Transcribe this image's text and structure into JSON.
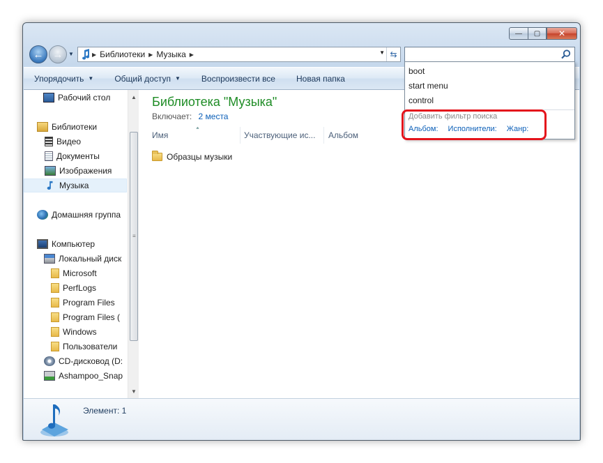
{
  "window": {
    "buttons": {
      "minimize": "—",
      "maximize": "▢",
      "close": "✕"
    }
  },
  "address": {
    "crumbs": [
      "Библиотеки",
      "Музыка"
    ],
    "separator": "▶",
    "dropdown": "▼",
    "refresh": "⇆"
  },
  "search": {
    "value": "",
    "placeholder": ""
  },
  "toolbar": {
    "items": [
      "Упорядочить",
      "Общий доступ",
      "Воспроизвести все",
      "Новая папка"
    ],
    "arrow": "▼"
  },
  "nav": {
    "items": [
      {
        "label": "Рабочий стол",
        "icon": "desktop-icon"
      },
      {
        "label": "Библиотеки",
        "icon": "libraries-icon"
      },
      {
        "label": "Видео",
        "icon": "video-icon"
      },
      {
        "label": "Документы",
        "icon": "documents-icon"
      },
      {
        "label": "Изображения",
        "icon": "pictures-icon"
      },
      {
        "label": "Музыка",
        "icon": "music-icon",
        "selected": true
      },
      {
        "label": "Домашняя группа",
        "icon": "homegroup-icon"
      },
      {
        "label": "Компьютер",
        "icon": "computer-icon"
      },
      {
        "label": "Локальный диск",
        "icon": "drive-icon"
      },
      {
        "label": "Microsoft",
        "icon": "folder-icon"
      },
      {
        "label": "PerfLogs",
        "icon": "folder-icon"
      },
      {
        "label": "Program Files",
        "icon": "folder-icon"
      },
      {
        "label": "Program Files (",
        "icon": "folder-icon"
      },
      {
        "label": "Windows",
        "icon": "folder-icon"
      },
      {
        "label": "Пользователи",
        "icon": "folder-icon"
      },
      {
        "label": "CD-дисковод (D:",
        "icon": "cd-drive-icon"
      },
      {
        "label": "Ashampoo_Snap",
        "icon": "network-drive-icon"
      }
    ]
  },
  "library": {
    "title": "Библиотека \"Музыка\"",
    "includes_label": "Включает:",
    "includes_link": "2 места"
  },
  "columns": [
    "Имя",
    "Участвующие ис...",
    "Альбом"
  ],
  "files": [
    {
      "name": "Образцы музыки",
      "icon": "folder-icon"
    }
  ],
  "status": {
    "text": "Элемент: 1"
  },
  "search_dropdown": {
    "history": [
      "boot",
      "start menu",
      "control"
    ],
    "filter_hint": "Добавить фильтр поиска",
    "filters": [
      "Альбом:",
      "Исполнители:",
      "Жанр:"
    ]
  },
  "colors": {
    "library_title": "#1e8c25",
    "link": "#0b5fb8",
    "highlight": "#e4131b"
  }
}
